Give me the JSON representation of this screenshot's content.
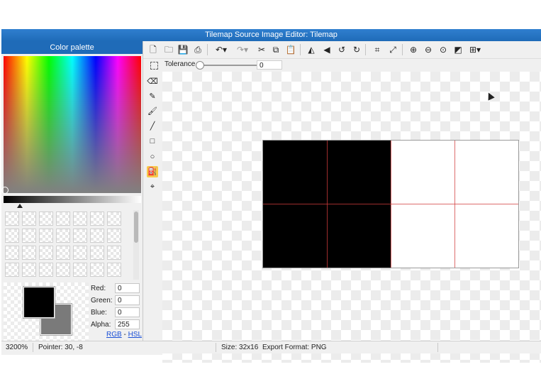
{
  "window": {
    "title": "Tilemap Source Image Editor: Tilemap"
  },
  "palette": {
    "title": "Color palette",
    "foreground": "#000000",
    "background": "#7a7a7a",
    "fields": [
      {
        "label": "Red:",
        "value": "0"
      },
      {
        "label": "Green:",
        "value": "0"
      },
      {
        "label": "Blue:",
        "value": "0"
      },
      {
        "label": "Alpha:",
        "value": "255"
      }
    ],
    "mode_links": {
      "rgb": "RGB",
      "separator": "-",
      "hsl": "HSL"
    }
  },
  "toolbar": {
    "icons": [
      "new-file-icon",
      "open-folder-icon",
      "save-icon",
      "export-icon",
      "undo-icon",
      "redo-icon",
      "cut-icon",
      "copy-icon",
      "paste-icon",
      "flip-horizontal-icon",
      "flip-vertical-icon",
      "rotate-left-icon",
      "rotate-right-icon",
      "crop-icon",
      "resize-icon",
      "zoom-in-icon",
      "zoom-out-icon",
      "zoom-fit-icon",
      "checkerboard-icon",
      "grid-icon"
    ]
  },
  "options": {
    "tolerance_label": "Tolerance",
    "tolerance_value": "0",
    "tolerance_level": 0
  },
  "tools": {
    "active": "fill-bucket-icon",
    "items": [
      "select-icon",
      "eraser-icon",
      "pencil-icon",
      "brush-icon",
      "line-icon",
      "rectangle-icon",
      "ellipse-icon",
      "fill-bucket-icon",
      "eyedropper-icon"
    ]
  },
  "canvas": {
    "tiles": [
      {
        "color": "#000000"
      },
      {
        "color": "#ffffff"
      }
    ],
    "grid_color": "#d23c3c"
  },
  "status": {
    "zoom": "3200%",
    "pointer": "Pointer: 30, -8",
    "size": "Size: 32x16",
    "export_format": "Export Format: PNG"
  }
}
